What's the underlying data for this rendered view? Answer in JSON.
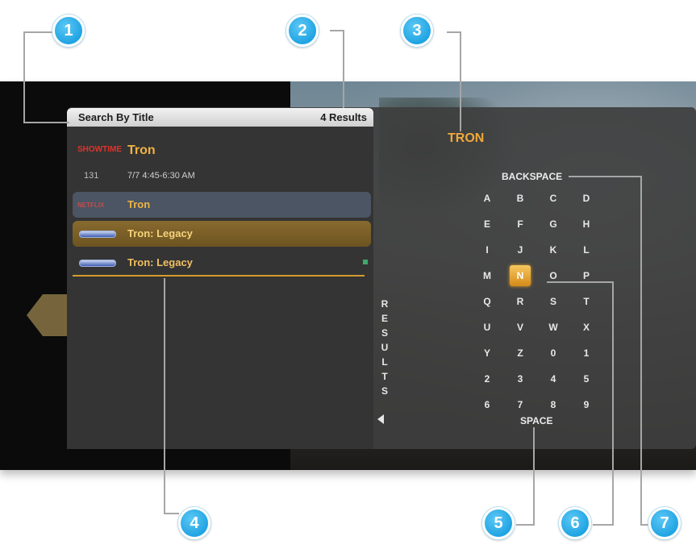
{
  "header": {
    "title": "Search By Title",
    "count": "4 Results"
  },
  "list": {
    "row1": {
      "network": "SHOWTIME",
      "title": "Tron"
    },
    "row2": {
      "channel": "131",
      "time": "7/7 4:45-6:30 AM"
    },
    "row3": {
      "network": "NETFLIX",
      "title": "Tron"
    },
    "row4": {
      "title": "Tron: Legacy"
    },
    "row5": {
      "title": "Tron: Legacy"
    }
  },
  "results_label": [
    "R",
    "E",
    "S",
    "U",
    "L",
    "T",
    "S"
  ],
  "keyboard": {
    "query": "TRON",
    "backspace": "BACKSPACE",
    "space": "SPACE",
    "selected_key": "N",
    "keys": [
      [
        "A",
        "B",
        "C",
        "D"
      ],
      [
        "E",
        "F",
        "G",
        "H"
      ],
      [
        "I",
        "J",
        "K",
        "L"
      ],
      [
        "M",
        "N",
        "O",
        "P"
      ],
      [
        "Q",
        "R",
        "S",
        "T"
      ],
      [
        "U",
        "V",
        "W",
        "X"
      ],
      [
        "Y",
        "Z",
        "0",
        "1"
      ],
      [
        "2",
        "3",
        "4",
        "5"
      ],
      [
        "6",
        "7",
        "8",
        "9"
      ]
    ]
  },
  "callouts": [
    "1",
    "2",
    "3",
    "4",
    "5",
    "6",
    "7"
  ],
  "colors": {
    "accent": "#f0a93b",
    "callout": "#20a4e3",
    "panel": "#3e3e3e"
  }
}
